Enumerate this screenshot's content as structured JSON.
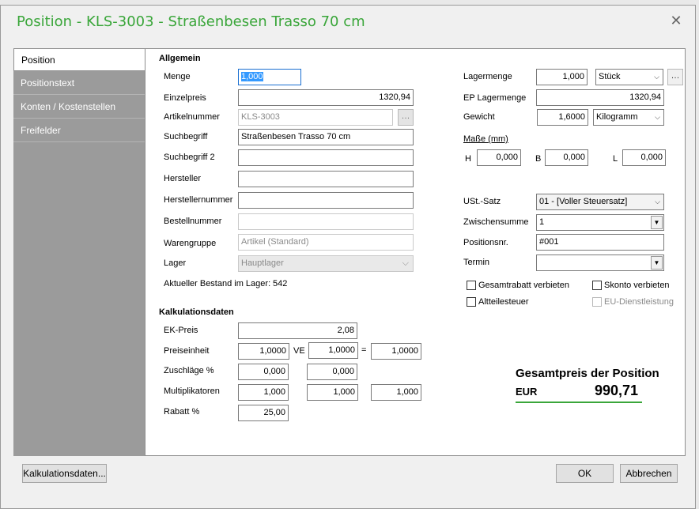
{
  "window": {
    "title": "Position - KLS-3003 - Straßenbesen Trasso 70 cm"
  },
  "nav": {
    "items": [
      "Position",
      "Positionstext",
      "Konten / Kostenstellen",
      "Freifelder"
    ]
  },
  "allgemein": {
    "heading": "Allgemein",
    "menge_label": "Menge",
    "menge": "1,000",
    "einzelpreis_label": "Einzelpreis",
    "einzelpreis": "1320,94",
    "artikelnummer_label": "Artikelnummer",
    "artikelnummer": "KLS-3003",
    "suchbegriff_label": "Suchbegriff",
    "suchbegriff": "Straßenbesen Trasso 70 cm",
    "suchbegriff2_label": "Suchbegriff 2",
    "suchbegriff2": "",
    "hersteller_label": "Hersteller",
    "hersteller": "",
    "herstellernummer_label": "Herstellernummer",
    "herstellernummer": "",
    "bestellnummer_label": "Bestellnummer",
    "bestellnummer": "",
    "warengruppe_label": "Warengruppe",
    "warengruppe": "Artikel (Standard)",
    "lager_label": "Lager",
    "lager": "Hauptlager",
    "bestand_label": "Aktueller Bestand im Lager:",
    "bestand": "542"
  },
  "rechts": {
    "lagermenge_label": "Lagermenge",
    "lagermenge": "1,000",
    "lagermenge_unit": "Stück",
    "ep_lagermenge_label": "EP Lagermenge",
    "ep_lagermenge": "1320,94",
    "gewicht_label": "Gewicht",
    "gewicht": "1,6000",
    "gewicht_unit": "Kilogramm",
    "masse_label": "Maße (mm)",
    "h_label": "H",
    "h": "0,000",
    "b_label": "B",
    "b": "0,000",
    "l_label": "L",
    "l": "0,000",
    "ust_label": "USt.-Satz",
    "ust": "01 - [Voller Steuersatz]",
    "zwischensumme_label": "Zwischensumme",
    "zwischensumme": "1",
    "positionsnr_label": "Positionsnr.",
    "positionsnr": "#001",
    "termin_label": "Termin",
    "termin": "",
    "gesamtrabatt_label": "Gesamtrabatt verbieten",
    "skonto_label": "Skonto verbieten",
    "altteilesteuer_label": "Altteilesteuer",
    "eu_label": "EU-Dienstleistung"
  },
  "kalkulation": {
    "heading": "Kalkulationsdaten",
    "ek_label": "EK-Preis",
    "ek": "2,08",
    "preiseinheit_label": "Preiseinheit",
    "preiseinheit": "1,0000",
    "ve_label": "VE",
    "ve": "1,0000",
    "eq_label": "=",
    "ergebnis": "1,0000",
    "zuschlaege_label": "Zuschläge %",
    "zuschlag1": "0,000",
    "zuschlag2": "0,000",
    "multiplikatoren_label": "Multiplikatoren",
    "multi1": "1,000",
    "multi2": "1,000",
    "multi3": "1,000",
    "rabatt_label": "Rabatt %",
    "rabatt": "25,00"
  },
  "total": {
    "title": "Gesamtpreis der Position",
    "currency": "EUR",
    "value": "990,71"
  },
  "buttons": {
    "kalkulation": "Kalkulationsdaten...",
    "ok": "OK",
    "abbrechen": "Abbrechen"
  },
  "colors": {
    "accent": "#3aa63a",
    "nav_bg": "#9b9b9b"
  }
}
